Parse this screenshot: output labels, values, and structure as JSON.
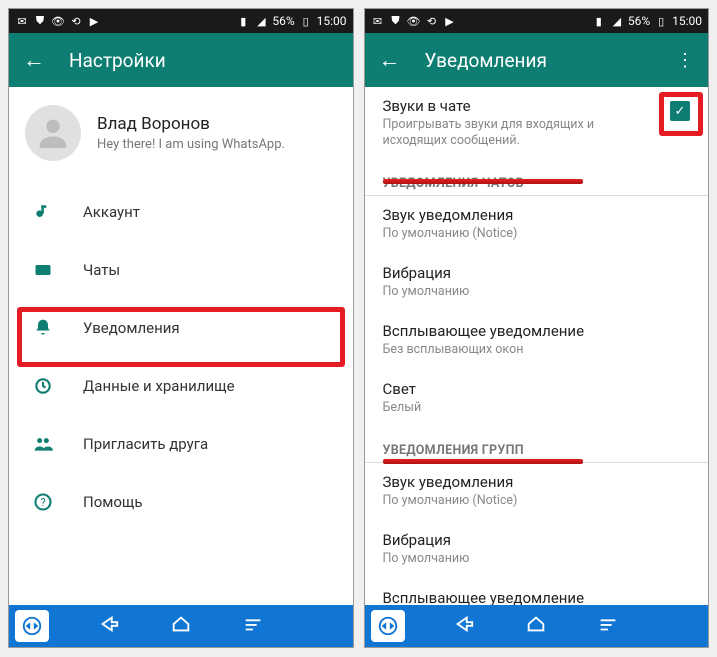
{
  "status": {
    "battery": "56%",
    "time": "15:00"
  },
  "left": {
    "title": "Настройки",
    "profile": {
      "name": "Влад Воронов",
      "status": "Hey there! I am using WhatsApp."
    },
    "items": [
      {
        "icon": "key",
        "label": "Аккаунт"
      },
      {
        "icon": "chat",
        "label": "Чаты"
      },
      {
        "icon": "bell",
        "label": "Уведомления"
      },
      {
        "icon": "data",
        "label": "Данные и хранилище"
      },
      {
        "icon": "invite",
        "label": "Пригласить друга"
      },
      {
        "icon": "help",
        "label": "Помощь"
      }
    ]
  },
  "right": {
    "title": "Уведомления",
    "chat_sounds": {
      "title": "Звуки в чате",
      "sub": "Проигрывать звуки для входящих и исходящих сообщений.",
      "checked": true
    },
    "section1": "УВЕДОМЛЕНИЯ ЧАТОВ",
    "rows1": [
      {
        "title": "Звук уведомления",
        "sub": "По умолчанию (Notice)"
      },
      {
        "title": "Вибрация",
        "sub": "По умолчанию"
      },
      {
        "title": "Всплывающее уведомление",
        "sub": "Без всплывающих окон"
      },
      {
        "title": "Свет",
        "sub": "Белый"
      }
    ],
    "section2": "УВЕДОМЛЕНИЯ ГРУПП",
    "rows2": [
      {
        "title": "Звук уведомления",
        "sub": "По умолчанию (Notice)"
      },
      {
        "title": "Вибрация",
        "sub": "По умолчанию"
      },
      {
        "title": "Всплывающее уведомление",
        "sub": ""
      }
    ]
  }
}
